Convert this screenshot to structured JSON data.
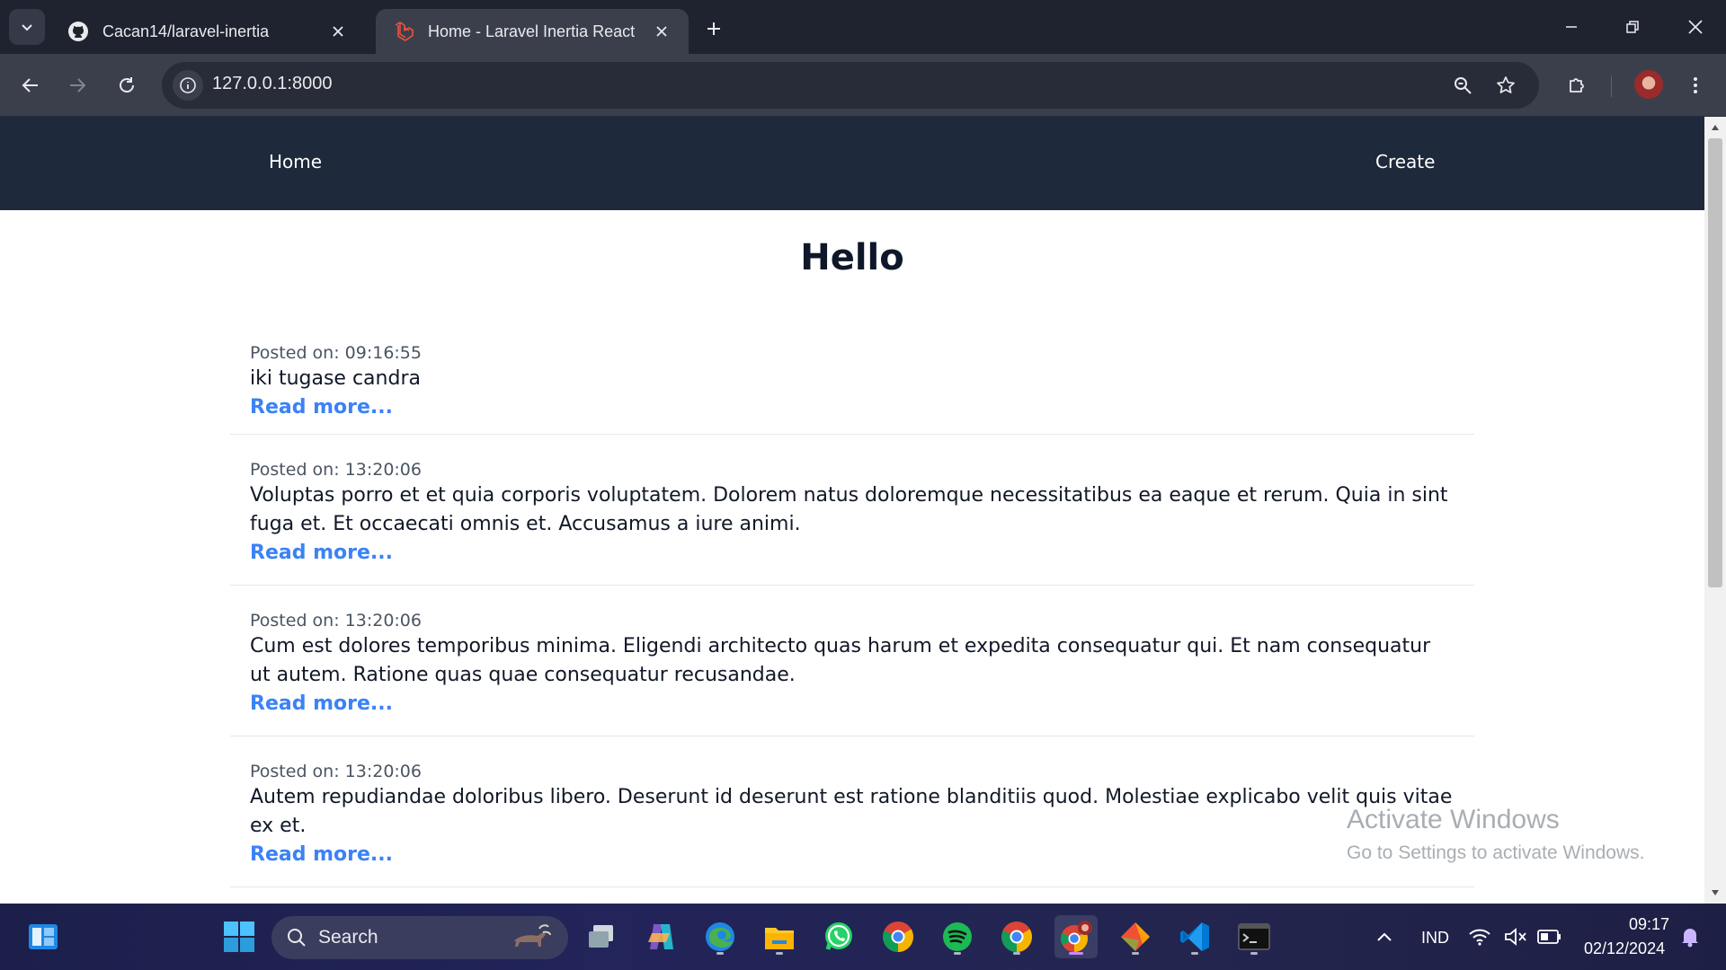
{
  "browser": {
    "tabs": [
      {
        "title": "Cacan14/laravel-inertia",
        "icon": "github-icon",
        "active": false
      },
      {
        "title": "Home - Laravel Inertia React",
        "icon": "laravel-icon",
        "active": true
      }
    ],
    "url": "127.0.0.1:8000"
  },
  "site": {
    "nav": {
      "home_label": "Home",
      "create_label": "Create"
    },
    "title": "Hello",
    "posts": [
      {
        "meta": "Posted on: 09:16:55",
        "body": "iki tugase candra",
        "link": "Read more..."
      },
      {
        "meta": "Posted on: 13:20:06",
        "body": "Voluptas porro et et quia corporis voluptatem. Dolorem natus doloremque necessitatibus ea eaque et rerum. Quia in sint fuga et. Et occaecati omnis et. Accusamus a iure animi.",
        "link": "Read more..."
      },
      {
        "meta": "Posted on: 13:20:06",
        "body": "Cum est dolores temporibus minima. Eligendi architecto quas harum et expedita consequatur qui. Et nam consequatur ut autem. Ratione quas quae consequatur recusandae.",
        "link": "Read more..."
      },
      {
        "meta": "Posted on: 13:20:06",
        "body": "Autem repudiandae doloribus libero. Deserunt id deserunt est ratione blanditiis quod. Molestiae explicabo velit quis vitae ex et.",
        "link": "Read more..."
      }
    ]
  },
  "watermark": {
    "title": "Activate Windows",
    "subtitle": "Go to Settings to activate Windows."
  },
  "taskbar": {
    "search_label": "Search",
    "language": "IND",
    "time": "09:17",
    "date": "02/12/2024",
    "apps": [
      "windows-start-icon",
      "task-view-icon",
      "copilot-icon",
      "edge-icon",
      "file-explorer-icon",
      "whatsapp-icon",
      "chrome-icon",
      "spotify-icon",
      "chrome-icon",
      "chrome-profile-icon",
      "git-icon",
      "vscode-icon",
      "terminal-icon"
    ]
  },
  "colors": {
    "nav_bg": "#1e293b",
    "link": "#3b82f6",
    "chrome_dark": "#1f2330",
    "chrome_toolbar": "#3b3f4c"
  }
}
